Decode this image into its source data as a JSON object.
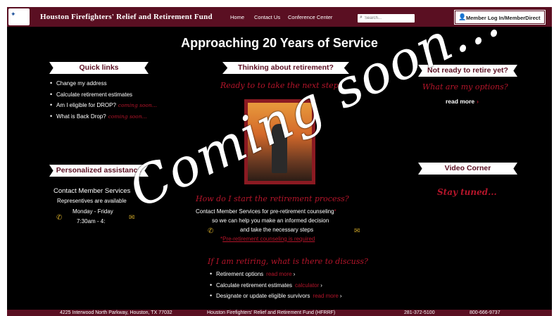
{
  "header": {
    "brand": "Houston Firefighters' Relief and Retirement Fund",
    "nav": [
      "Home",
      "Contact Us",
      "Conference Center"
    ],
    "search_placeholder": "Search...",
    "login_label": "Member Log In/MemberDirect"
  },
  "headline": "Approaching 20 Years of Service",
  "quick_links": {
    "title": "Quick links",
    "items": [
      {
        "label": "Change my address",
        "note": ""
      },
      {
        "label": "Calculate retirement estimates",
        "note": ""
      },
      {
        "label": "Am I eligible for DROP?",
        "note": "coming soon..."
      },
      {
        "label": "What is Back Drop?",
        "note": "coming soon..."
      }
    ]
  },
  "personalized": {
    "title": "Personalized assistance",
    "contact": "Contact Member Services",
    "reps": "Representives are available",
    "days": "Monday - Friday",
    "hours": "7:30am - 4:"
  },
  "thinking": {
    "title": "Thinking about retirement?",
    "subtitle": "Ready to to take the next step?",
    "question": "How do I start the retirement process?",
    "line1": "Contact Member Services for pre-retirement counseling",
    "line1_mark": "*",
    "line2": "so we can help you make an informed decision",
    "line3": "and take the necessary steps",
    "required_mark": "*",
    "required": "Pre-retirement counseling is required"
  },
  "discuss": {
    "title": "If I am retiring, what is there to discuss?",
    "items": [
      {
        "label": "Retirement options",
        "link": "read more"
      },
      {
        "label": "Calculate retirement estimates",
        "link": "calculator"
      },
      {
        "label": "Designate or update eligible survivors",
        "link": "read more"
      }
    ]
  },
  "not_ready": {
    "title": "Not ready to retire yet?",
    "subtitle": "What are my options?",
    "read_more": "read more"
  },
  "video": {
    "title": "Video Corner",
    "subtitle": "Stay tuned..."
  },
  "overlay": "Coming soon...",
  "footer": {
    "address": "4225 Interwood North Parkway, Houston, TX 77032",
    "name": "Houston Firefighters' Relief and Retirement Fund (HFRRF)",
    "phone1": "281-372-5100",
    "phone2": "800-666-9737"
  },
  "colors": {
    "accent": "#5a0f22",
    "red": "#b4152a",
    "icon": "#c9a227"
  }
}
